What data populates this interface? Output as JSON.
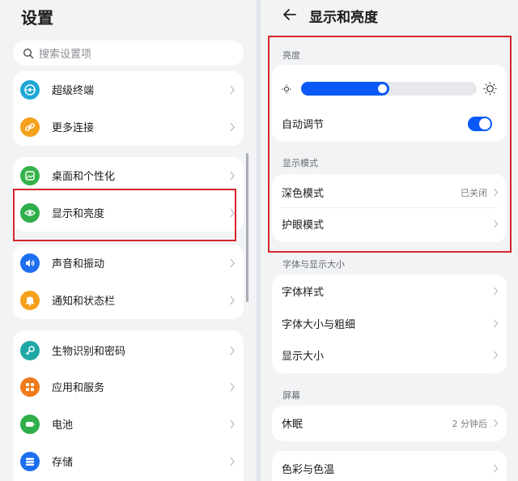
{
  "left": {
    "title": "设置",
    "search_placeholder": "搜索设置项",
    "groups": [
      {
        "items": [
          {
            "label": "超级终端",
            "icon": "super-device-icon",
            "color": "#1fa7d6"
          },
          {
            "label": "更多连接",
            "icon": "link-icon",
            "color": "#f5a11c"
          }
        ]
      },
      {
        "items": [
          {
            "label": "桌面和个性化",
            "icon": "wallpaper-icon",
            "color": "#35b34a"
          },
          {
            "label": "显示和亮度",
            "icon": "eye-icon",
            "color": "#2fae4a"
          }
        ]
      },
      {
        "items": [
          {
            "label": "声音和振动",
            "icon": "speaker-icon",
            "color": "#1d6ff2"
          },
          {
            "label": "通知和状态栏",
            "icon": "bell-icon",
            "color": "#f5a11c"
          }
        ]
      },
      {
        "items": [
          {
            "label": "生物识别和密码",
            "icon": "key-icon",
            "color": "#1fa7a5"
          },
          {
            "label": "应用和服务",
            "icon": "apps-icon",
            "color": "#f07a1a"
          },
          {
            "label": "电池",
            "icon": "battery-icon",
            "color": "#2fae4a"
          },
          {
            "label": "存储",
            "icon": "storage-icon",
            "color": "#1d6ff2"
          }
        ]
      }
    ]
  },
  "right": {
    "title": "显示和亮度",
    "brightness_section": "亮度",
    "brightness_level": 0.5,
    "auto_adjust": {
      "label": "自动调节",
      "on": true
    },
    "display_mode_section": "显示模式",
    "dark_mode": {
      "label": "深色模式",
      "value": "已关闭"
    },
    "eye_comfort": {
      "label": "护眼模式"
    },
    "font_section": "字体与显示大小",
    "font_items": [
      {
        "label": "字体样式"
      },
      {
        "label": "字体大小与粗细"
      },
      {
        "label": "显示大小"
      }
    ],
    "screen_section": "屏幕",
    "sleep": {
      "label": "休眠",
      "value": "2 分钟后"
    },
    "color": {
      "label": "色彩与色温"
    }
  },
  "colors": {
    "accent": "#0a59f7",
    "highlight_border": "#d8262d",
    "background": "#f1f3f5"
  }
}
